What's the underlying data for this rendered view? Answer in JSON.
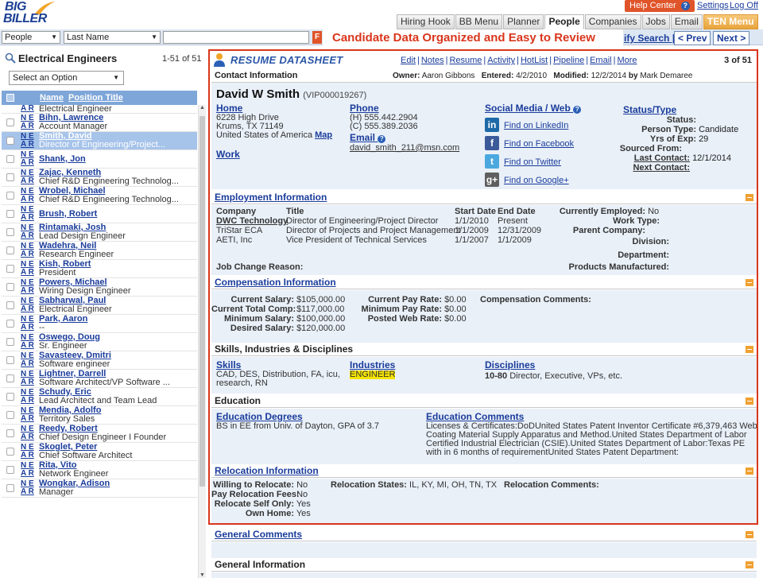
{
  "header": {
    "logo_line1": "BIG",
    "logo_line2": "BILLER",
    "help_center": "Help Center",
    "settings": "Settings",
    "logoff": "Log Off",
    "nav_tabs": [
      {
        "label": "Hiring Hook"
      },
      {
        "label": "BB Menu"
      },
      {
        "label": "Planner"
      },
      {
        "label": "People"
      },
      {
        "label": "Companies"
      },
      {
        "label": "Jobs"
      },
      {
        "label": "Email"
      },
      {
        "label": "TEN Menu"
      }
    ]
  },
  "searchbar": {
    "entity": "People",
    "field": "Last Name",
    "query": "",
    "go": "F",
    "banner": "Candidate Data Organized and Easy to Review",
    "modify": "ify Search",
    "prev": "< Prev",
    "next": "Next >"
  },
  "list": {
    "title": "Electrical Engineers",
    "count": "1-51 of 51",
    "select_option": "Select an Option",
    "col_name": "Name",
    "col_position": "Position Title",
    "ne": "N E",
    "ar": "A R",
    "first_row_title": "Electrical Engineer",
    "rows": [
      {
        "name": "Bihn, Lawrence",
        "title": "Account Manager"
      },
      {
        "name": "Smith, David",
        "title": "Director of Engineering/Project..."
      },
      {
        "name": "Shank, Jon",
        "title": ""
      },
      {
        "name": "Zajac, Kenneth",
        "title": "Chief R&D Engineering Technolog..."
      },
      {
        "name": "Wrobel, Michael",
        "title": "Chief R&D Engineering Technolog..."
      },
      {
        "name": "Brush, Robert",
        "title": ""
      },
      {
        "name": "Rintamaki, Josh",
        "title": "Lead Design Engineer"
      },
      {
        "name": "Wadehra, Neil",
        "title": "Research Engineer"
      },
      {
        "name": "Kish, Robert",
        "title": "President"
      },
      {
        "name": "Powers, Michael",
        "title": "Wiring Design Engineer"
      },
      {
        "name": "Sabharwal, Paul",
        "title": "Electrical Engineer"
      },
      {
        "name": "Park, Aaron",
        "title": "--"
      },
      {
        "name": "Oswego, Doug",
        "title": "Sr. Engineer"
      },
      {
        "name": "Savasteev, Dmitri",
        "title": "Software engineer"
      },
      {
        "name": "Lightner, Darrell",
        "title": "Software Architect/VP Software ..."
      },
      {
        "name": "Schudy, Eric",
        "title": "Lead Architect and Team Lead"
      },
      {
        "name": "Mendia, Adolfo",
        "title": "Territory Sales"
      },
      {
        "name": "Reedy, Robert",
        "title": "Chief Design Engineer I Founder"
      },
      {
        "name": "Skoglet, Peter",
        "title": "Chief Software Architect"
      },
      {
        "name": "Rita, Vito",
        "title": "Network Engineer"
      },
      {
        "name": "Wongkar, Adison",
        "title": "Manager"
      }
    ]
  },
  "resume": {
    "title": "RESUME DATASHEET",
    "actions": [
      "Edit",
      "Notes",
      "Resume",
      "Activity",
      "HotList",
      "Pipeline",
      "Email",
      "More"
    ],
    "counter": "3 of 51",
    "contact_label": "Contact Information",
    "owner_label": "Owner:",
    "owner": "Aaron Gibbons",
    "entered_label": "Entered:",
    "entered": "4/2/2010",
    "modified_label": "Modified:",
    "modified": "12/2/2014",
    "by_label": "by",
    "modified_by": "Mark Demaree",
    "name": "David W Smith",
    "vip": "(VIP000019267)",
    "home_label": "Home",
    "address1": "6228 High Drive",
    "address2": "Krums, TX 71149",
    "country": "United States of America",
    "map": "Map",
    "work_label": "Work",
    "phone_label": "Phone",
    "phone_h": "(H) 555.442.2904",
    "phone_c": "(C) 555.389.2036",
    "email_label": "Email",
    "email": "david_smith_211@msn.com",
    "social_label": "Social Media / Web",
    "social": [
      {
        "icon": "in",
        "label": "Find on LinkedIn",
        "color": "#1e6aa8"
      },
      {
        "icon": "f",
        "label": "Find on Facebook",
        "color": "#3b5a99"
      },
      {
        "icon": "t",
        "label": "Find on Twitter",
        "color": "#4aa8de"
      },
      {
        "icon": "g+",
        "label": "Find on Google+",
        "color": "#5f5f5f"
      }
    ],
    "status_label": "Status/Type",
    "status": {
      "status_k": "Status:",
      "status_v": "",
      "ptype_k": "Person Type:",
      "ptype_v": "Candidate",
      "yrs_k": "Yrs of Exp:",
      "yrs_v": "29",
      "sourced_k": "Sourced From:",
      "sourced_v": "",
      "last_k": "Last Contact:",
      "last_v": "12/1/2014",
      "next_k": "Next Contact:",
      "next_v": ""
    },
    "employment": {
      "heading": "Employment Information",
      "col_company": "Company",
      "col_title": "Title",
      "col_start": "Start Date",
      "col_end": "End Date",
      "rows": [
        {
          "company": "DWC Technology",
          "title": "Director of Engineering/Project Director",
          "start": "1/1/2010",
          "end": "Present"
        },
        {
          "company": "TriStar ECA",
          "title": "Director of Projects and Project Management",
          "start": "1/1/2009",
          "end": "12/31/2009"
        },
        {
          "company": "AETI, Inc",
          "title": "Vice President of Technical Services",
          "start": "1/1/2007",
          "end": "1/1/2009"
        }
      ],
      "job_change": "Job Change Reason:",
      "currently_k": "Currently Employed:",
      "currently_v": "No",
      "worktype_k": "Work Type:",
      "parent_k": "Parent Company:",
      "division_k": "Division:",
      "department_k": "Department:",
      "products_k": "Products Manufactured:"
    },
    "compensation": {
      "heading": "Compensation Information",
      "cur_sal_k": "Current Salary:",
      "cur_sal_v": "$105,000.00",
      "tot_comp_k": "Current Total Comp:",
      "tot_comp_v": "$117,000.00",
      "min_sal_k": "Minimum Salary:",
      "min_sal_v": "$100,000.00",
      "des_sal_k": "Desired Salary:",
      "des_sal_v": "$120,000.00",
      "cur_pay_k": "Current Pay Rate:",
      "cur_pay_v": "$0.00",
      "min_pay_k": "Minimum Pay Rate:",
      "min_pay_v": "$0.00",
      "web_k": "Posted Web Rate:",
      "web_v": "$0.00",
      "comments_k": "Compensation Comments:"
    },
    "skills": {
      "heading": "Skills, Industries & Disciplines",
      "skills_label": "Skills",
      "skills_line1": "CAD, DES, Distribution, FA, icu,",
      "skills_line2": "research, RN",
      "industries_label": "Industries",
      "industry": "ENGINEER",
      "disciplines_label": "Disciplines",
      "discipline_code": "10-80",
      "discipline": "Director, Executive, VPs, etc."
    },
    "education": {
      "heading": "Education",
      "degrees_label": "Education Degrees",
      "degree": "BS in EE from Univ. of Dayton, GPA of 3.7",
      "comments_label": "Education Comments",
      "comments": [
        "Licenses & Certificates:DoDUnited States Patent Inventor Certificate #6,379,463 Web",
        "Coating Material Supply Apparatus and Method.United States Department of Labor",
        "Certified Industrial Electrician (CSIE).United States Department of Labor:Texas PE",
        "with in 6 months of requirementUnited States Patent Department:"
      ]
    },
    "relocation": {
      "heading": "Relocation Information",
      "willing_k": "Willing to Relocate:",
      "willing_v": "No",
      "fees_k": "Pay Relocation Fees:",
      "fees_v": "No",
      "self_k": "Relocate Self Only:",
      "self_v": "Yes",
      "home_k": "Own Home:",
      "home_v": "Yes",
      "states_k": "Relocation States:",
      "states_v": "IL, KY, MI, OH, TN, TX",
      "comments_k": "Relocation Comments:"
    },
    "general_comments": "General Comments",
    "general_info": "General Information"
  },
  "colors": {
    "accent_red": "#d9361c",
    "link_blue": "#1a3c9b",
    "section_bg": "#e9f0f8",
    "list_header": "#7ea6d8",
    "selected_row": "#a6c3ea"
  }
}
